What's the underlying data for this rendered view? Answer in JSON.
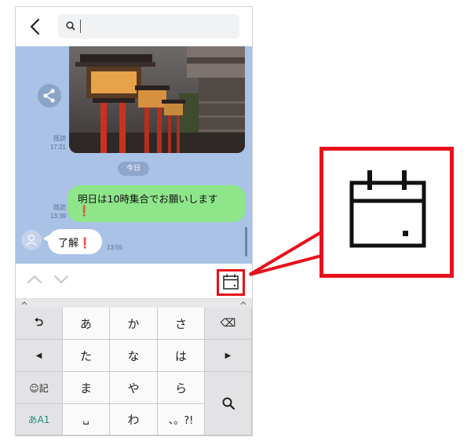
{
  "search": {
    "placeholder": ""
  },
  "chat": {
    "messages": [
      {
        "read_label": "既読",
        "time": "17:21"
      },
      {
        "read_label": "既読",
        "time": "13:39",
        "text": "明日は10時集合でお願いします",
        "emoji": "❗"
      },
      {
        "text": "了解",
        "emoji": "❗",
        "time": "13:55"
      }
    ],
    "date_separator": "今日"
  },
  "keyboard": {
    "keys": {
      "r1": [
        "⮌",
        "あ",
        "か",
        "さ",
        "⌫"
      ],
      "r2": [
        "◀",
        "た",
        "な",
        "は",
        "▶"
      ],
      "r3": [
        "☺記",
        "ま",
        "や",
        "ら",
        "🔍"
      ],
      "r4": [
        "あA1",
        "␣",
        "わ",
        "、。?!"
      ]
    }
  },
  "icons": {
    "back": "chevron-left-icon",
    "search": "search-icon",
    "share": "share-icon",
    "calendar": "calendar-icon",
    "up": "chevron-up-icon",
    "down": "chevron-down-icon"
  },
  "colors": {
    "chat_bg": "#a9c2e6",
    "my_bubble": "#8ee58a",
    "highlight": "#e8101a"
  }
}
